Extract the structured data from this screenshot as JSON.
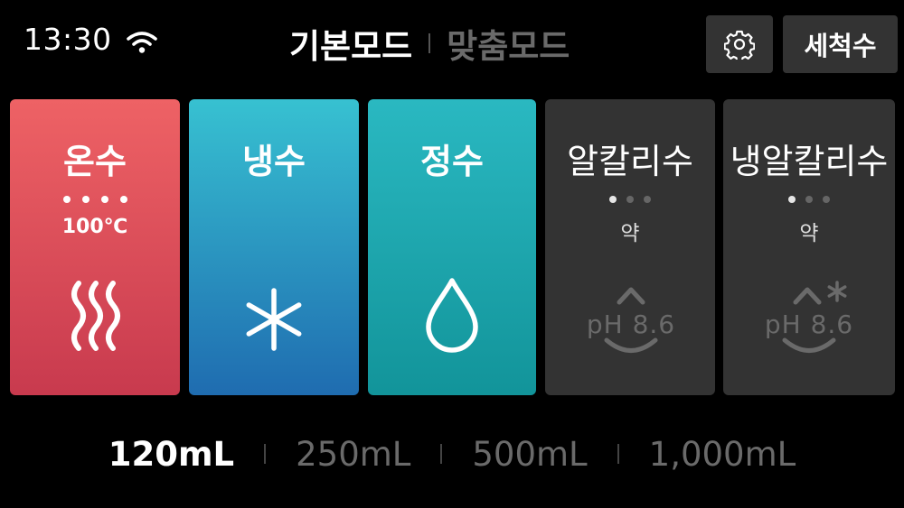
{
  "status": {
    "time": "13:30",
    "wifi_icon": "wifi-icon"
  },
  "header": {
    "modes": [
      {
        "label": "기본모드",
        "active": true
      },
      {
        "label": "맞춤모드",
        "active": false
      }
    ],
    "settings_icon": "gear-icon",
    "clean_label": "세척수"
  },
  "cards": [
    {
      "title": "온수",
      "detail": "100℃",
      "level_dots": 4,
      "icon": "heat-waves-icon",
      "color_top": "#ee6265",
      "color_bottom": "#c83a4e"
    },
    {
      "title": "냉수",
      "icon": "snowflake-icon",
      "color_top": "#37c1d1",
      "color_bottom": "#1f6cb0"
    },
    {
      "title": "정수",
      "icon": "water-drop-icon",
      "color_top": "#2ab8c1",
      "color_bottom": "#12949a"
    },
    {
      "title": "알칼리수",
      "level": "약",
      "level_active": 1,
      "level_total": 3,
      "ph_label": "pH 8.6",
      "icon": "ph-smile-icon"
    },
    {
      "title": "냉알칼리수",
      "level": "약",
      "level_active": 1,
      "level_total": 3,
      "ph_label": "pH 8.6",
      "icon": "ph-smile-snow-icon"
    }
  ],
  "volumes": [
    {
      "label": "120mL",
      "active": true
    },
    {
      "label": "250mL",
      "active": false
    },
    {
      "label": "500mL",
      "active": false
    },
    {
      "label": "1,000mL",
      "active": false
    }
  ]
}
